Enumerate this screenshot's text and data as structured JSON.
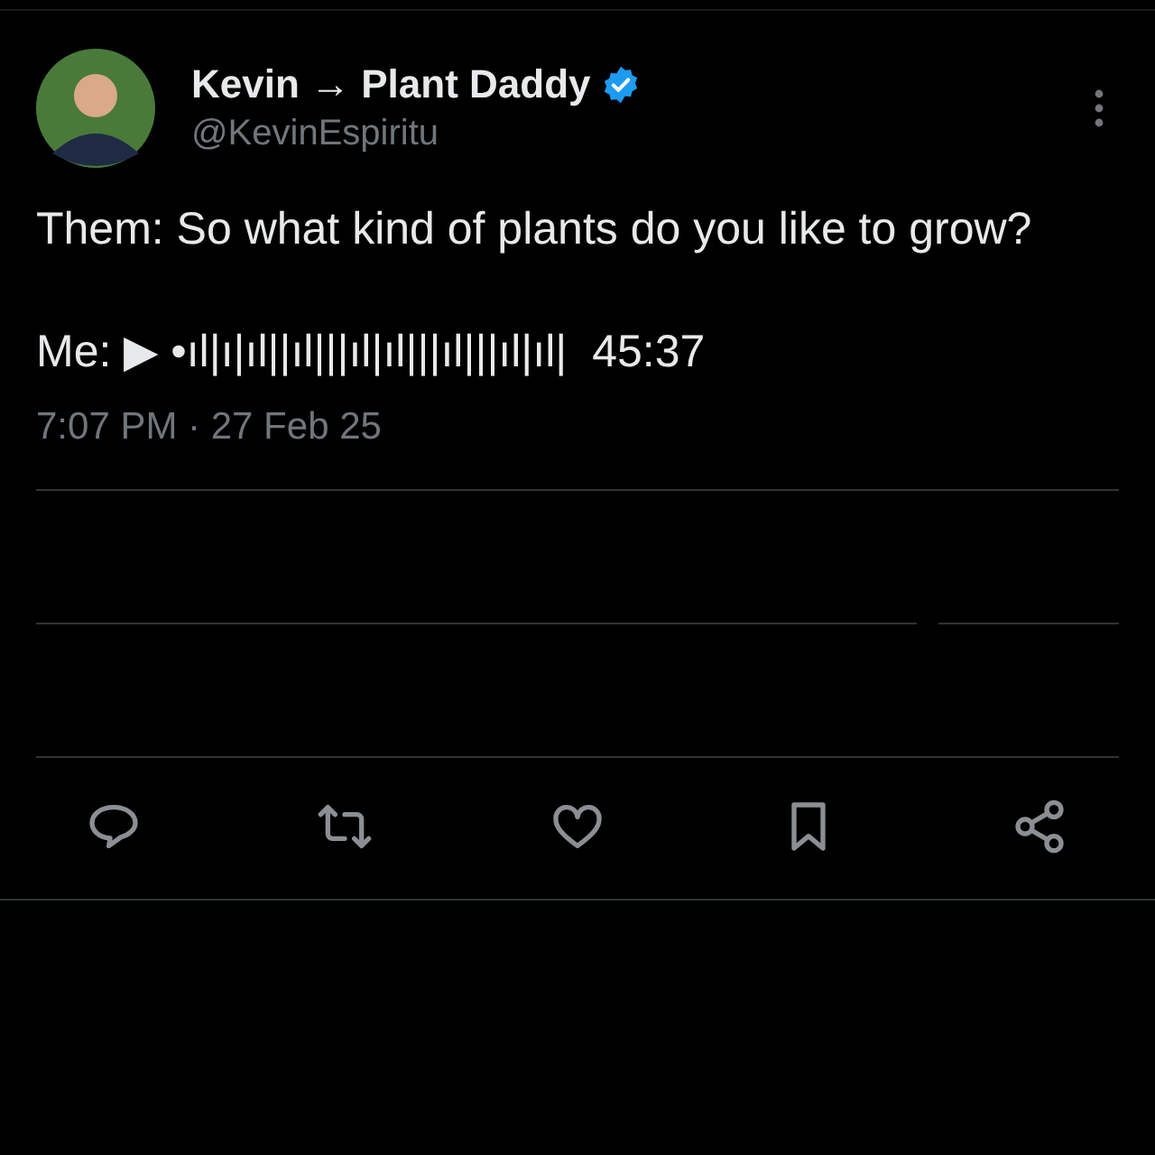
{
  "author": {
    "display_name": "Kevin → Plant Daddy",
    "verified": true,
    "handle": "@KevinEspiritu"
  },
  "tweet": {
    "lines": [
      "Them: So what kind of plants do you like to grow?",
      "Me: ▶ •ıl|ı|ıl||ıl|||ıl|ıl|||ıl|||ıl|ıl|  45:37"
    ]
  },
  "timestamp": "7:07 PM · 27 Feb 25",
  "actions": [
    {
      "kind": "reply"
    },
    {
      "kind": "repost"
    },
    {
      "kind": "like"
    },
    {
      "kind": "bookmark"
    },
    {
      "kind": "share"
    }
  ]
}
